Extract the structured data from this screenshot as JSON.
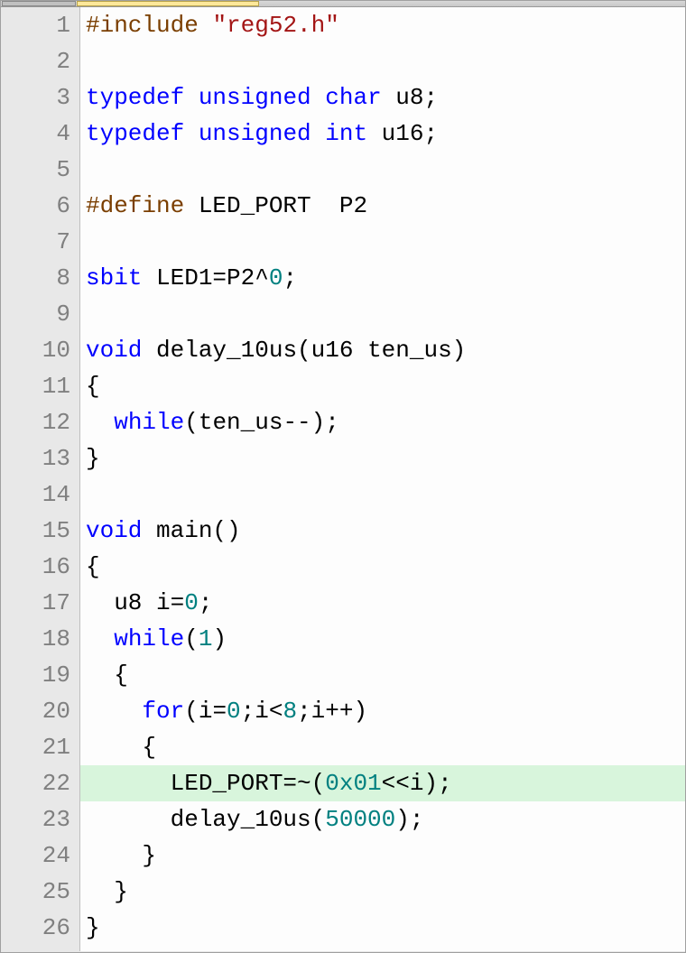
{
  "lines": [
    {
      "n": 1,
      "hl": false,
      "tokens": [
        [
          "pp",
          "#include "
        ],
        [
          "str",
          "\"reg52.h\""
        ]
      ]
    },
    {
      "n": 2,
      "hl": false,
      "tokens": []
    },
    {
      "n": 3,
      "hl": false,
      "tokens": [
        [
          "kw",
          "typedef"
        ],
        [
          "id",
          " "
        ],
        [
          "kw",
          "unsigned"
        ],
        [
          "id",
          " "
        ],
        [
          "kw",
          "char"
        ],
        [
          "id",
          " u8;"
        ]
      ]
    },
    {
      "n": 4,
      "hl": false,
      "tokens": [
        [
          "kw",
          "typedef"
        ],
        [
          "id",
          " "
        ],
        [
          "kw",
          "unsigned"
        ],
        [
          "id",
          " "
        ],
        [
          "kw",
          "int"
        ],
        [
          "id",
          " u16;"
        ]
      ]
    },
    {
      "n": 5,
      "hl": false,
      "tokens": []
    },
    {
      "n": 6,
      "hl": false,
      "tokens": [
        [
          "pp",
          "#define"
        ],
        [
          "id",
          " LED_PORT  P2"
        ]
      ]
    },
    {
      "n": 7,
      "hl": false,
      "tokens": []
    },
    {
      "n": 8,
      "hl": false,
      "tokens": [
        [
          "kw",
          "sbit"
        ],
        [
          "id",
          " LED1=P2^"
        ],
        [
          "num",
          "0"
        ],
        [
          "id",
          ";"
        ]
      ]
    },
    {
      "n": 9,
      "hl": false,
      "tokens": []
    },
    {
      "n": 10,
      "hl": false,
      "tokens": [
        [
          "kw",
          "void"
        ],
        [
          "id",
          " delay_10us(u16 ten_us)"
        ]
      ]
    },
    {
      "n": 11,
      "hl": false,
      "tokens": [
        [
          "id",
          "{"
        ]
      ]
    },
    {
      "n": 12,
      "hl": false,
      "tokens": [
        [
          "id",
          "  "
        ],
        [
          "kw",
          "while"
        ],
        [
          "id",
          "(ten_us--);"
        ]
      ]
    },
    {
      "n": 13,
      "hl": false,
      "tokens": [
        [
          "id",
          "}"
        ]
      ]
    },
    {
      "n": 14,
      "hl": false,
      "tokens": []
    },
    {
      "n": 15,
      "hl": false,
      "tokens": [
        [
          "kw",
          "void"
        ],
        [
          "id",
          " main()"
        ]
      ]
    },
    {
      "n": 16,
      "hl": false,
      "tokens": [
        [
          "id",
          "{"
        ]
      ]
    },
    {
      "n": 17,
      "hl": false,
      "tokens": [
        [
          "id",
          "  u8 i="
        ],
        [
          "num",
          "0"
        ],
        [
          "id",
          ";"
        ]
      ]
    },
    {
      "n": 18,
      "hl": false,
      "tokens": [
        [
          "id",
          "  "
        ],
        [
          "kw",
          "while"
        ],
        [
          "id",
          "("
        ],
        [
          "num",
          "1"
        ],
        [
          "id",
          ")"
        ]
      ]
    },
    {
      "n": 19,
      "hl": false,
      "tokens": [
        [
          "id",
          "  {"
        ]
      ]
    },
    {
      "n": 20,
      "hl": false,
      "tokens": [
        [
          "id",
          "    "
        ],
        [
          "kw",
          "for"
        ],
        [
          "id",
          "(i="
        ],
        [
          "num",
          "0"
        ],
        [
          "id",
          ";i<"
        ],
        [
          "num",
          "8"
        ],
        [
          "id",
          ";i++)"
        ]
      ]
    },
    {
      "n": 21,
      "hl": false,
      "tokens": [
        [
          "id",
          "    {"
        ]
      ]
    },
    {
      "n": 22,
      "hl": true,
      "tokens": [
        [
          "id",
          "      LED_PORT=~("
        ],
        [
          "num",
          "0x01"
        ],
        [
          "id",
          "<<i);"
        ]
      ]
    },
    {
      "n": 23,
      "hl": false,
      "tokens": [
        [
          "id",
          "      delay_10us("
        ],
        [
          "num",
          "50000"
        ],
        [
          "id",
          ");"
        ]
      ]
    },
    {
      "n": 24,
      "hl": false,
      "tokens": [
        [
          "id",
          "    }"
        ]
      ]
    },
    {
      "n": 25,
      "hl": false,
      "tokens": [
        [
          "id",
          "  }"
        ]
      ]
    },
    {
      "n": 26,
      "hl": false,
      "tokens": [
        [
          "id",
          "}"
        ]
      ]
    }
  ]
}
